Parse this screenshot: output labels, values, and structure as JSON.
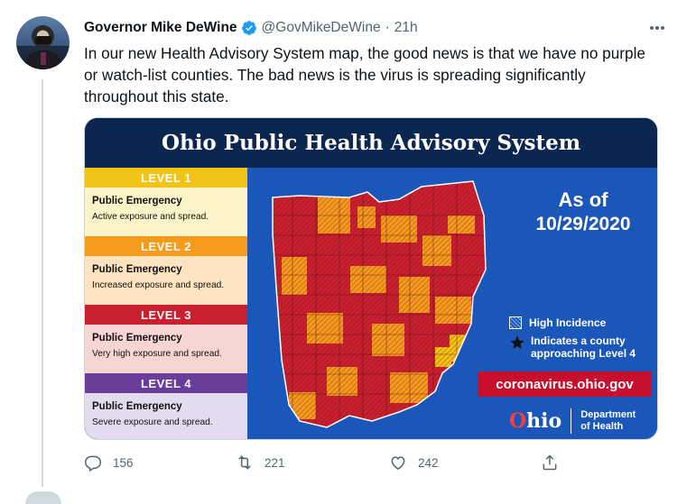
{
  "tweet": {
    "author_name": "Governor Mike DeWine",
    "handle": "@GovMikeDeWine",
    "separator": "·",
    "time": "21h",
    "text": "In our new Health Advisory System map, the good news is that we have no purple or watch-list counties. The bad news is the virus is spreading significantly throughout this state."
  },
  "card": {
    "title": "Ohio Public Health Advisory System",
    "levels": [
      {
        "label": "LEVEL 1",
        "heading": "Public Emergency",
        "desc": "Active exposure and spread.",
        "color": "#f2c317",
        "body_color": "#fdf3c8"
      },
      {
        "label": "LEVEL 2",
        "heading": "Public Emergency",
        "desc": "Increased exposure and spread.",
        "color": "#f49b1e",
        "body_color": "#fde3bf"
      },
      {
        "label": "LEVEL 3",
        "heading": "Public Emergency",
        "desc": "Very high exposure and spread.",
        "color": "#c8202f",
        "body_color": "#f6d5d3"
      },
      {
        "label": "LEVEL 4",
        "heading": "Public Emergency",
        "desc": "Severe exposure and spread.",
        "color": "#6b3d9a",
        "body_color": "#e3dbee"
      }
    ],
    "as_of_label": "As of",
    "as_of_date": "10/29/2020",
    "key_high_incidence": "High Incidence",
    "key_level4_line1": "Indicates a county",
    "key_level4_line2": "approaching Level 4",
    "url": "coronavirus.ohio.gov",
    "logo_o": "O",
    "logo_rest": "hio",
    "dept_line1": "Department",
    "dept_line2": "of Health"
  },
  "actions": {
    "replies": "156",
    "retweets": "221",
    "likes": "242"
  },
  "colors": {
    "level2": "#f49b1e",
    "level3": "#c8202f",
    "level1": "#f2c317",
    "map_bg": "#1b57b8"
  }
}
